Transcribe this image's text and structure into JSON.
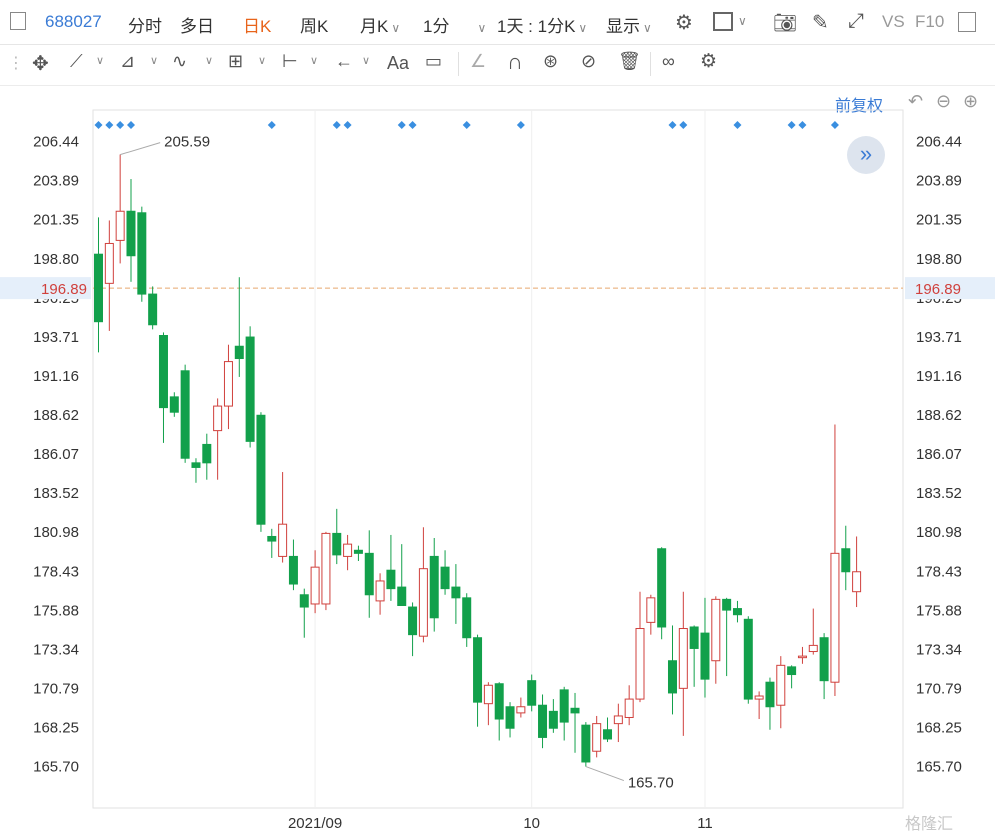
{
  "topbar": {
    "code": "688027",
    "tabs": [
      "分时",
      "多日",
      "日K",
      "周K",
      "月K",
      "1分"
    ],
    "active_tab": "日K",
    "period_select": "1天 : 1分K",
    "display_label": "显示",
    "vs_label": "VS",
    "f10_label": "F10"
  },
  "toolbar": {
    "font_label": "Aa",
    "fuquan_label": "前复权"
  },
  "watermark": "格隆汇",
  "colors": {
    "up": "#d0403c",
    "down": "#12a04b",
    "ref": "#e8a86e",
    "accent": "#3a7bd5",
    "active": "#e8641b"
  },
  "chart_data": {
    "type": "candlestick",
    "x_labels": [
      {
        "label": "2021/09",
        "index": 20
      },
      {
        "label": "10",
        "index": 40
      },
      {
        "label": "11",
        "index": 56
      }
    ],
    "y_ticks": [
      206.44,
      203.89,
      201.35,
      198.8,
      196.25,
      193.71,
      191.16,
      188.62,
      186.07,
      183.52,
      180.98,
      178.43,
      175.88,
      173.34,
      170.79,
      168.25,
      165.7
    ],
    "ylim": [
      163.0,
      208.5
    ],
    "current_price": "196.89",
    "high_label": {
      "value": "205.59",
      "index": 2
    },
    "low_label": {
      "value": "165.70",
      "index": 45
    },
    "event_markers": [
      0,
      1,
      2,
      3,
      16,
      22,
      23,
      28,
      29,
      34,
      39,
      53,
      54,
      59,
      64,
      65,
      68
    ],
    "candles": [
      [
        199.1,
        194.7,
        201.5,
        192.7
      ],
      [
        197.2,
        199.8,
        201.3,
        194.1
      ],
      [
        200.0,
        201.9,
        205.6,
        198.5
      ],
      [
        201.9,
        199.0,
        204.0,
        197.3
      ],
      [
        201.8,
        196.5,
        202.2,
        196.0
      ],
      [
        196.5,
        194.5,
        197.0,
        194.2
      ],
      [
        193.8,
        189.1,
        194.0,
        186.8
      ],
      [
        189.8,
        188.8,
        190.1,
        188.5
      ],
      [
        191.5,
        185.8,
        191.9,
        185.5
      ],
      [
        185.5,
        185.2,
        185.8,
        184.2
      ],
      [
        186.7,
        185.5,
        187.4,
        184.4
      ],
      [
        187.6,
        189.2,
        189.7,
        184.4
      ],
      [
        189.2,
        192.1,
        193.2,
        187.7
      ],
      [
        193.1,
        192.3,
        197.6,
        191.1
      ],
      [
        193.7,
        186.9,
        194.4,
        186.5
      ],
      [
        188.6,
        181.5,
        188.8,
        181.0
      ],
      [
        180.7,
        180.4,
        181.2,
        179.3
      ],
      [
        179.4,
        181.5,
        184.9,
        179.0
      ],
      [
        179.4,
        177.6,
        180.5,
        177.2
      ],
      [
        176.9,
        176.1,
        177.3,
        174.1
      ],
      [
        176.3,
        178.7,
        179.8,
        175.7
      ],
      [
        176.3,
        180.9,
        181.0,
        175.9
      ],
      [
        180.9,
        179.5,
        182.5,
        178.9
      ],
      [
        179.4,
        180.2,
        180.8,
        178.5
      ],
      [
        179.8,
        179.6,
        180.1,
        179.1
      ],
      [
        179.6,
        176.9,
        181.1,
        175.4
      ],
      [
        176.5,
        177.8,
        178.3,
        175.6
      ],
      [
        178.5,
        177.3,
        180.8,
        176.5
      ],
      [
        177.4,
        176.2,
        180.2,
        176.3
      ],
      [
        176.1,
        174.3,
        176.4,
        172.9
      ],
      [
        174.2,
        178.6,
        181.3,
        173.8
      ],
      [
        179.4,
        175.4,
        180.6,
        174.5
      ],
      [
        178.7,
        177.3,
        179.8,
        176.9
      ],
      [
        177.4,
        176.7,
        178.9,
        175.0
      ],
      [
        176.7,
        174.1,
        177.0,
        173.5
      ],
      [
        174.1,
        169.9,
        174.3,
        168.3
      ],
      [
        169.8,
        171.0,
        171.2,
        168.4
      ],
      [
        171.1,
        168.8,
        171.2,
        167.4
      ],
      [
        169.6,
        168.2,
        169.9,
        167.6
      ],
      [
        169.2,
        169.6,
        170.2,
        168.9
      ],
      [
        171.3,
        169.7,
        171.7,
        169.3
      ],
      [
        169.7,
        167.6,
        170.4,
        166.9
      ],
      [
        169.3,
        168.2,
        170.1,
        167.9
      ],
      [
        170.7,
        168.6,
        170.9,
        167.4
      ],
      [
        169.5,
        169.2,
        170.5,
        166.6
      ],
      [
        168.4,
        166.0,
        168.6,
        165.7
      ],
      [
        166.7,
        168.5,
        169.0,
        166.3
      ],
      [
        168.1,
        167.5,
        168.9,
        167.3
      ],
      [
        168.5,
        169.0,
        169.8,
        167.3
      ],
      [
        168.9,
        170.1,
        171.0,
        168.4
      ],
      [
        170.1,
        174.7,
        177.1,
        169.9
      ],
      [
        175.1,
        176.7,
        176.9,
        174.3
      ],
      [
        179.9,
        174.8,
        180.0,
        174.0
      ],
      [
        172.6,
        170.5,
        174.9,
        169.1
      ],
      [
        170.8,
        174.7,
        177.1,
        167.7
      ],
      [
        174.8,
        173.4,
        174.9,
        170.9
      ],
      [
        174.4,
        171.4,
        176.7,
        170.2
      ],
      [
        172.6,
        176.6,
        176.8,
        171.1
      ],
      [
        176.6,
        175.9,
        176.7,
        171.6
      ],
      [
        176.0,
        175.6,
        176.5,
        175.1
      ],
      [
        175.3,
        170.1,
        175.5,
        169.8
      ],
      [
        170.1,
        170.3,
        170.6,
        168.8
      ],
      [
        171.2,
        169.6,
        171.5,
        168.1
      ],
      [
        169.7,
        172.3,
        172.9,
        168.2
      ],
      [
        172.2,
        171.7,
        172.3,
        170.8
      ],
      [
        172.8,
        172.9,
        173.5,
        172.4
      ],
      [
        173.2,
        173.6,
        176.0,
        173.0
      ],
      [
        174.1,
        171.3,
        174.4,
        170.1
      ],
      [
        171.2,
        179.6,
        188.0,
        170.3
      ],
      [
        179.9,
        178.4,
        181.4,
        177.2
      ],
      [
        177.1,
        178.4,
        180.7,
        176.1
      ]
    ]
  }
}
